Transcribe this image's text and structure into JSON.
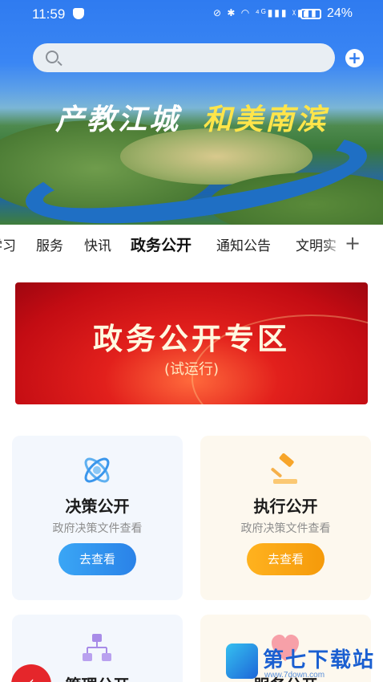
{
  "status_bar": {
    "time": "11:59",
    "icons": "⊘ ✱ ◠ ⁴ᴳ▮▮▮ ᵡ▮▮▮",
    "battery": "24%"
  },
  "search": {
    "placeholder": ""
  },
  "header": {
    "slogan_part1": "产教江城",
    "slogan_part2": "和美南滨"
  },
  "tabs": [
    {
      "label": "学习"
    },
    {
      "label": "服务"
    },
    {
      "label": "快讯"
    },
    {
      "label": "政务公开",
      "active": true
    },
    {
      "label": "通知公告"
    },
    {
      "label": "文明实"
    }
  ],
  "tab_add": "+",
  "banner": {
    "title": "政务公开专区",
    "subtitle": "(试运行)"
  },
  "cards": [
    {
      "title": "决策公开",
      "desc": "政府决策文件查看",
      "button": "去查看",
      "icon": "atom-icon",
      "button_color": "#2a82e8"
    },
    {
      "title": "执行公开",
      "desc": "政府决策文件查看",
      "button": "去查看",
      "icon": "gavel-icon",
      "button_color": "#f59a0a"
    },
    {
      "title": "管理公开",
      "icon": "org-chart-icon"
    },
    {
      "title": "服务公开",
      "icon": "heart-icon"
    }
  ],
  "watermark": {
    "text": "第七下载站",
    "url": "www.7down.com"
  },
  "colors": {
    "primary": "#2f7bf0",
    "banner_red": "#d4141a",
    "accent_orange": "#f59a0a",
    "accent_blue": "#2a82e8"
  }
}
